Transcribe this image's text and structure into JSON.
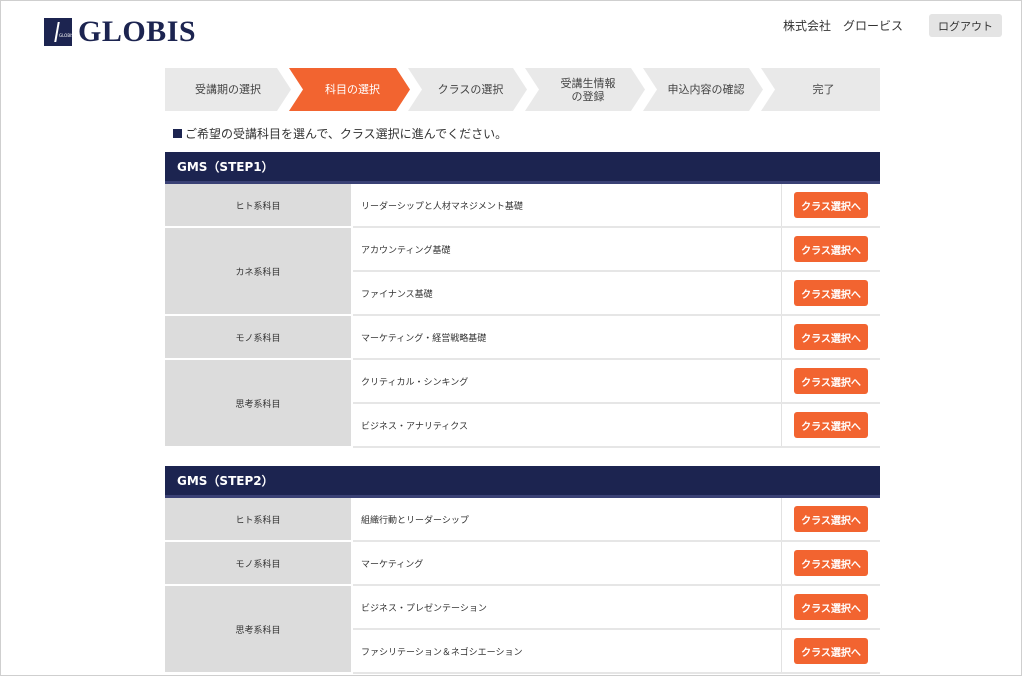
{
  "header": {
    "logo_text": "GLOBIS",
    "logo_mark_text": "GLOBIS",
    "company": "株式会社　グロービス",
    "logout_label": "ログアウト"
  },
  "steps": [
    {
      "label": "受講期の選択",
      "active": false
    },
    {
      "label": "科目の選択",
      "active": true
    },
    {
      "label": "クラスの選択",
      "active": false
    },
    {
      "label": "受講生情報\nの登録",
      "active": false
    },
    {
      "label": "申込内容の確認",
      "active": false
    },
    {
      "label": "完了",
      "active": false
    }
  ],
  "instruction": "ご希望の受講科目を選んで、クラス選択に進んでください。",
  "button_label": "クラス選択へ",
  "sections": [
    {
      "title": "GMS（STEP1）",
      "groups": [
        {
          "category": "ヒト系科目",
          "courses": [
            "リーダーシップと人材マネジメント基礎"
          ]
        },
        {
          "category": "カネ系科目",
          "courses": [
            "アカウンティング基礎",
            "ファイナンス基礎"
          ]
        },
        {
          "category": "モノ系科目",
          "courses": [
            "マーケティング・経営戦略基礎"
          ]
        },
        {
          "category": "思考系科目",
          "courses": [
            "クリティカル・シンキング",
            "ビジネス・アナリティクス"
          ]
        }
      ]
    },
    {
      "title": "GMS（STEP2）",
      "groups": [
        {
          "category": "ヒト系科目",
          "courses": [
            "組織行動とリーダーシップ"
          ]
        },
        {
          "category": "モノ系科目",
          "courses": [
            "マーケティング"
          ]
        },
        {
          "category": "思考系科目",
          "courses": [
            "ビジネス・プレゼンテーション",
            "ファシリテーション＆ネゴシエーション"
          ]
        }
      ]
    }
  ],
  "colors": {
    "navy": "#1c2450",
    "accent": "#f26430",
    "step_bg": "#e9e9e9",
    "category_bg": "#dcdcdc"
  }
}
